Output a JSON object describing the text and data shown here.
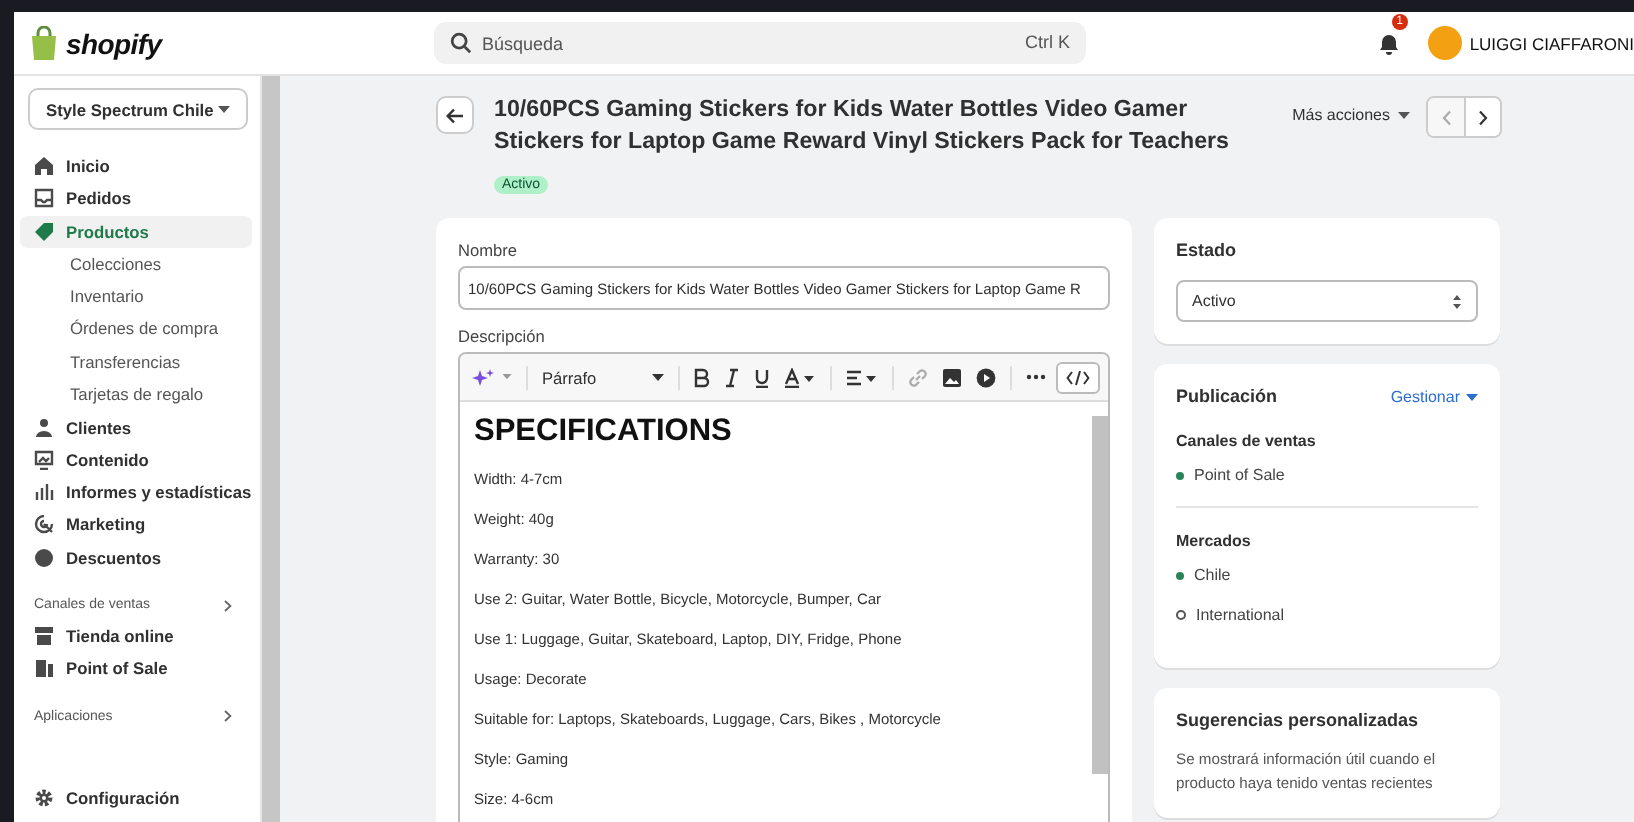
{
  "topbar": {
    "logo": "shopify",
    "search": {
      "placeholder": "Búsqueda",
      "shortcut": "Ctrl K"
    },
    "notifications": "1",
    "user": "LUIGGI CIAFFARONI"
  },
  "sidebar": {
    "store": "Style Spectrum Chile",
    "items": [
      {
        "label": "Inicio",
        "selected": false
      },
      {
        "label": "Pedidos",
        "selected": false
      },
      {
        "label": "Productos",
        "selected": true,
        "children": [
          {
            "label": "Colecciones"
          },
          {
            "label": "Inventario"
          },
          {
            "label": "Órdenes de compra"
          },
          {
            "label": "Transferencias"
          },
          {
            "label": "Tarjetas de regalo"
          }
        ]
      },
      {
        "label": "Clientes",
        "selected": false
      },
      {
        "label": "Contenido",
        "selected": false
      },
      {
        "label": "Informes y estadísticas",
        "selected": false
      },
      {
        "label": "Marketing",
        "selected": false
      },
      {
        "label": "Descuentos",
        "selected": false
      }
    ],
    "sections": [
      {
        "title": "Canales de ventas",
        "items": [
          {
            "label": "Tienda online"
          },
          {
            "label": "Point of Sale"
          }
        ]
      },
      {
        "title": "Aplicaciones"
      }
    ],
    "settings": "Configuración"
  },
  "product": {
    "title": "10/60PCS Gaming Stickers for Kids Water Bottles Video Gamer Stickers for Laptop Game Reward Vinyl Stickers Pack for Teachers",
    "status_badge": "Activo",
    "more_actions": "Más acciones",
    "name_label": "Nombre",
    "name_value": "10/60PCS Gaming Stickers for Kids Water Bottles Video Gamer Stickers for Laptop Game R",
    "description_label": "Descripción",
    "paragraph_style": "Párrafo",
    "description_heading": "SPECIFICATIONS",
    "description_lines": [
      "Width: 4-7cm",
      "Weight: 40g",
      "Warranty: 30",
      "Use 2: Guitar, Water Bottle, Bicycle, Motorcycle, Bumper, Car",
      "Use 1: Luggage, Guitar, Skateboard, Laptop, DIY, Fridge, Phone",
      "Usage: Decorate",
      "Suitable for: Laptops, Skateboards, Luggage, Cars, Bikes , Motorcycle",
      "Style: Gaming",
      "Size: 4-6cm"
    ]
  },
  "status_card": {
    "title": "Estado",
    "value": "Activo"
  },
  "publication": {
    "title": "Publicación",
    "manage": "Gestionar",
    "channels_title": "Canales de ventas",
    "channels": [
      {
        "label": "Point of Sale",
        "published": true
      }
    ],
    "markets_title": "Mercados",
    "markets": [
      {
        "label": "Chile",
        "published": true
      },
      {
        "label": "International",
        "published": false
      }
    ]
  },
  "suggestions": {
    "title": "Sugerencias personalizadas",
    "text": "Se mostrará información útil cuando el producto haya tenido ventas recientes"
  }
}
